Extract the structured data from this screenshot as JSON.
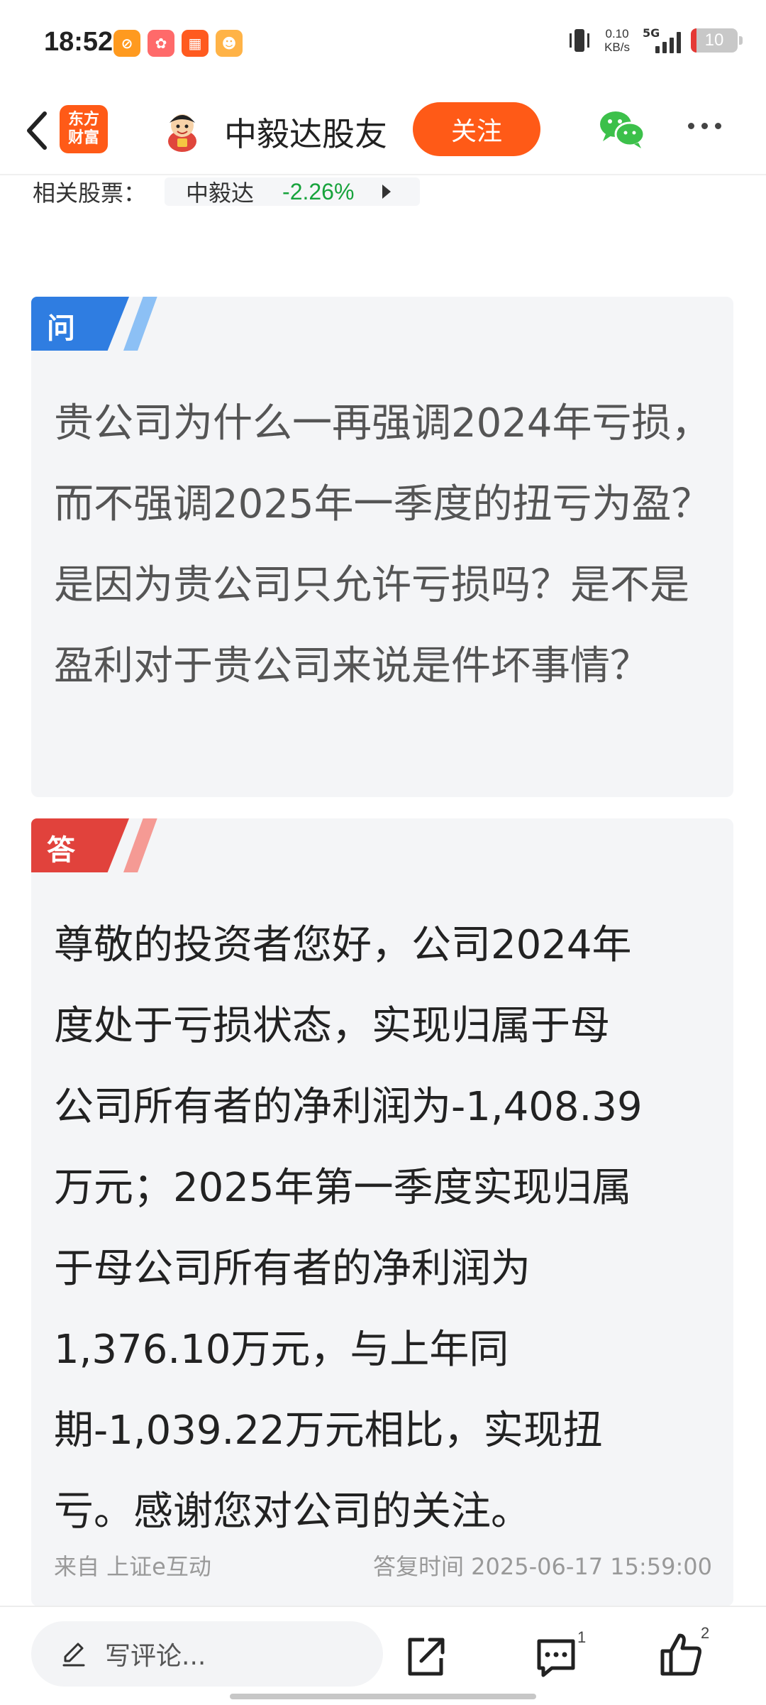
{
  "status_bar": {
    "time": "18:52",
    "net_speed_value": "0.10",
    "net_speed_unit": "KB/s",
    "network": "5G",
    "battery": "10",
    "notification_icons": [
      "orange-app-icon",
      "pink-app-icon",
      "orange-grid-app-icon",
      "game-app-icon"
    ]
  },
  "nav": {
    "logo_line1": "东方",
    "logo_line2": "财富",
    "title": "中毅达股友",
    "follow_label": "关注"
  },
  "related": {
    "label": "相关股票：",
    "stock_name": "中毅达",
    "stock_change": "-2.26%",
    "change_color": "#17a33c"
  },
  "question": {
    "tag": "问",
    "text": "贵公司为什么一再强调2024年亏损，而不强调2025年一季度的扭亏为盈？是因为贵公司只允许亏损吗？是不是盈利对于贵公司来说是件坏事情？"
  },
  "answer": {
    "tag": "答",
    "lines": [
      "尊敬的投资者您好，公司2024年",
      "度处于亏损状态，实现归属于母",
      "公司所有者的净利润为-1,408.39",
      "万元；2025年第一季度实现归属",
      "于母公司所有者的净利润为",
      "1,376.10万元，与上年同",
      "期-1,039.22万元相比，实现扭",
      "亏。感谢您对公司的关注。"
    ],
    "source": "来自 上证e互动",
    "reply_time": "答复时间 2025-06-17 15:59:00"
  },
  "bottom_bar": {
    "comment_placeholder": "写评论...",
    "comment_count": "1",
    "like_count": "2"
  },
  "colors": {
    "brand_orange": "#ff5a17",
    "question_blue": "#2f7de1",
    "answer_red": "#e1423c"
  }
}
